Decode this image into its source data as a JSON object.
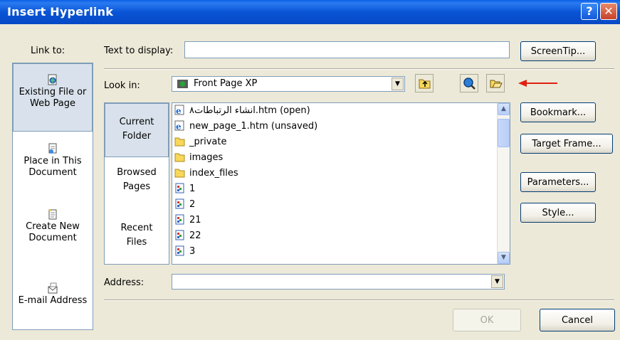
{
  "window": {
    "title": "Insert Hyperlink",
    "help_glyph": "?",
    "close_glyph": "✕"
  },
  "link_to": {
    "label": "Link to:",
    "items": [
      {
        "label_line1": "Existing File or",
        "label_line2": "Web Page",
        "icon": "web-page-icon"
      },
      {
        "label_line1": "Place in This",
        "label_line2": "Document",
        "icon": "document-place-icon"
      },
      {
        "label_line1": "Create New",
        "label_line2": "Document",
        "icon": "new-document-icon"
      },
      {
        "label_line1": "E-mail Address",
        "label_line2": "",
        "icon": "email-icon"
      }
    ]
  },
  "text_to_display": {
    "label": "Text to display:",
    "value": ""
  },
  "screentip_button": "ScreenTip...",
  "look_in": {
    "label": "Look in:",
    "value": "Front Page XP"
  },
  "toolbar": {
    "up_folder_icon": "up-folder-icon",
    "browse_web_icon": "browse-web-icon",
    "browse_file_icon": "browse-file-icon"
  },
  "annotation": {
    "arrow_color": "#E02010"
  },
  "folder_tabs": [
    {
      "line1": "Current",
      "line2": "Folder"
    },
    {
      "line1": "Browsed",
      "line2": "Pages"
    },
    {
      "line1": "Recent",
      "line2": "Files"
    }
  ],
  "files": [
    {
      "name": "انشاء الرتباطات٨.htm (open)",
      "icon": "web-page-icon"
    },
    {
      "name": "new_page_1.htm (unsaved)",
      "icon": "web-page-icon"
    },
    {
      "name": "_private",
      "icon": "folder-icon"
    },
    {
      "name": "images",
      "icon": "folder-icon"
    },
    {
      "name": "index_files",
      "icon": "folder-icon"
    },
    {
      "name": "1",
      "icon": "image-file-icon"
    },
    {
      "name": "2",
      "icon": "image-file-icon"
    },
    {
      "name": "21",
      "icon": "image-file-icon"
    },
    {
      "name": "22",
      "icon": "image-file-icon"
    },
    {
      "name": "3",
      "icon": "image-file-icon"
    }
  ],
  "address": {
    "label": "Address:",
    "value": ""
  },
  "right_buttons": {
    "bookmark": "Bookmark...",
    "target_frame": "Target Frame...",
    "parameters": "Parameters...",
    "style": "Style..."
  },
  "ok_button": "OK",
  "cancel_button": "Cancel",
  "colors": {
    "titlebar": "#0A5FE6",
    "dialog_bg": "#ECE9D8",
    "selected_bg": "#D9E2EC"
  }
}
